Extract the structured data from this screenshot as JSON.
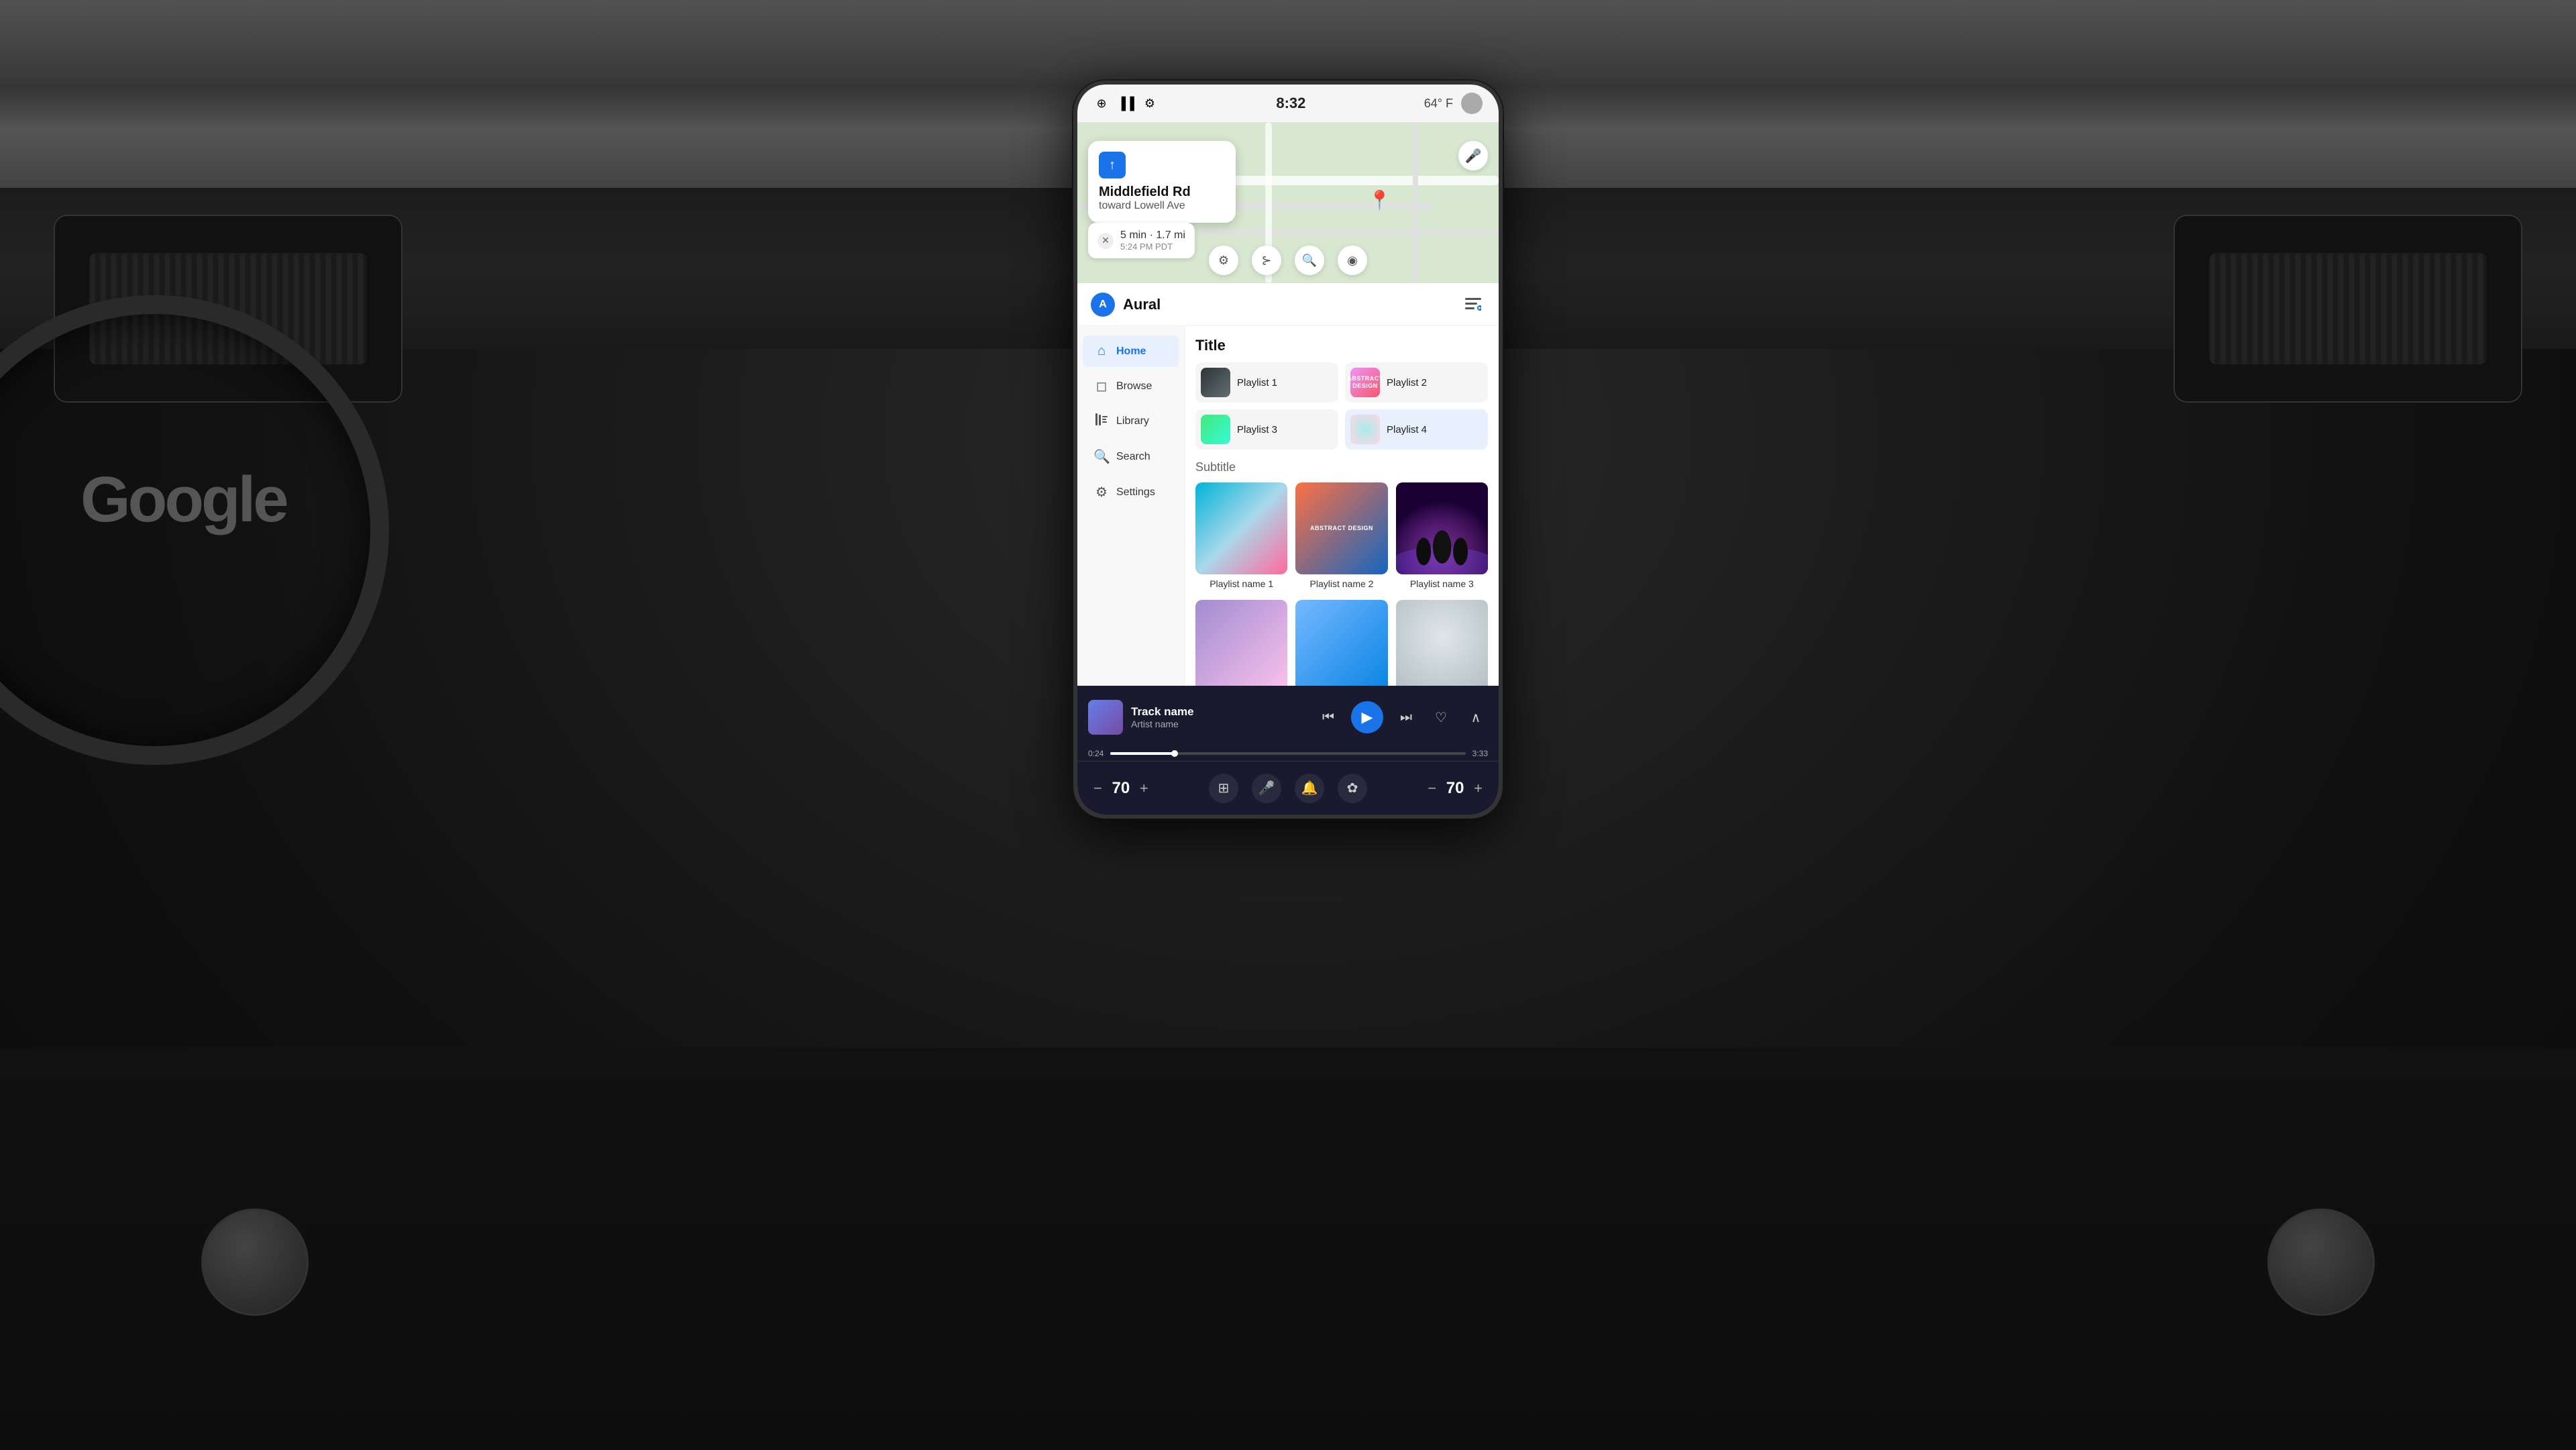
{
  "car": {
    "google_logo": "Google"
  },
  "statusBar": {
    "bluetooth_icon": "⊕",
    "signal_icon": "▐",
    "settings_icon": "⚙",
    "time": "8:32",
    "temp": "64° F"
  },
  "navigation": {
    "street": "Middlefield Rd",
    "direction": "toward Lowell Ave",
    "eta_time": "5 min · 1.7 mi",
    "eta_clock": "5:24 PM PDT",
    "location_icon": "◎",
    "close_icon": "✕",
    "map_controls": [
      {
        "icon": "⚙",
        "name": "map-settings"
      },
      {
        "icon": "⊱",
        "name": "map-route"
      },
      {
        "icon": "⌕",
        "name": "map-search"
      },
      {
        "icon": "◉",
        "name": "map-pin"
      }
    ]
  },
  "app": {
    "logo_letter": "A",
    "name": "Aural",
    "queue_icon": "≡"
  },
  "sidebar": {
    "items": [
      {
        "label": "Home",
        "icon": "⌂",
        "active": true,
        "name": "sidebar-item-home"
      },
      {
        "label": "Browse",
        "icon": "◫",
        "active": false,
        "name": "sidebar-item-browse"
      },
      {
        "label": "Library",
        "icon": "≡",
        "active": false,
        "name": "sidebar-item-library"
      },
      {
        "label": "Search",
        "icon": "⌕",
        "active": false,
        "name": "sidebar-item-search"
      },
      {
        "label": "Settings",
        "icon": "⚙",
        "active": false,
        "name": "sidebar-item-settings"
      }
    ]
  },
  "content": {
    "section1_title": "Title",
    "playlists_small": [
      {
        "label": "Playlist 1",
        "name": "playlist-1",
        "thumb_type": "dark"
      },
      {
        "label": "Playlist 2",
        "name": "playlist-2",
        "thumb_type": "abstract"
      },
      {
        "label": "Playlist 3",
        "name": "playlist-3",
        "thumb_type": "teal"
      },
      {
        "label": "Playlist 4",
        "name": "playlist-4",
        "thumb_type": "gradient4"
      }
    ],
    "section2_subtitle": "Subtitle",
    "playlists_large": [
      {
        "label": "Playlist name 1",
        "name": "playlist-name-1",
        "thumb_type": "girl"
      },
      {
        "label": "Playlist name 2",
        "name": "playlist-name-2",
        "thumb_type": "abstract2"
      },
      {
        "label": "Playlist name 3",
        "name": "playlist-name-3",
        "thumb_type": "concert"
      }
    ],
    "playlists_row2": [
      {
        "label": "",
        "name": "playlist-row2-1",
        "thumb_type": "purple"
      },
      {
        "label": "",
        "name": "playlist-row2-2",
        "thumb_type": "headphones"
      },
      {
        "label": "",
        "name": "playlist-row2-3",
        "thumb_type": "face"
      }
    ]
  },
  "player": {
    "track_name": "Track name",
    "artist_name": "Artist name",
    "current_time": "0:24",
    "total_time": "3:33",
    "progress_pct": 18,
    "prev_icon": "⏮",
    "play_icon": "▶",
    "next_icon": "⏭",
    "heart_icon": "♡",
    "expand_icon": "⌃"
  },
  "systemBar": {
    "vol_left_minus": "−",
    "vol_left_value": "70",
    "vol_left_plus": "+",
    "icons": [
      {
        "icon": "⊞",
        "name": "grid-icon"
      },
      {
        "icon": "♬",
        "name": "mic-icon"
      },
      {
        "icon": "🔔",
        "name": "bell-icon"
      },
      {
        "icon": "✿",
        "name": "settings2-icon"
      }
    ],
    "vol_right_minus": "−",
    "vol_right_value": "70",
    "vol_right_plus": "+"
  }
}
